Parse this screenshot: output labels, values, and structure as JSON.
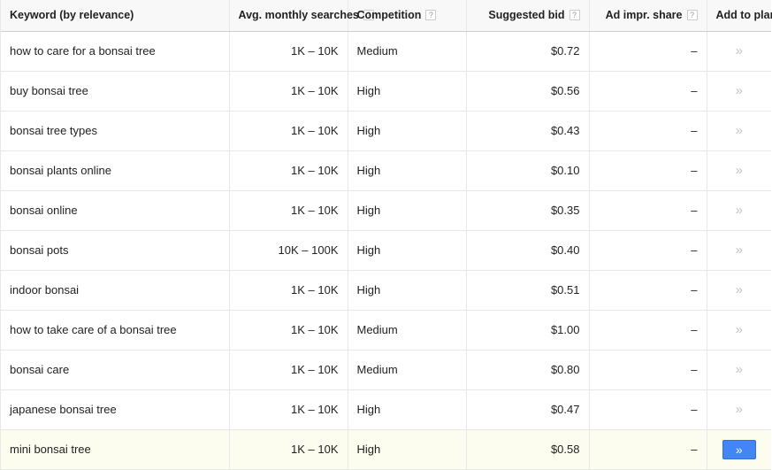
{
  "table": {
    "columns": [
      {
        "key": "keyword",
        "label": "Keyword (by relevance)",
        "help": false,
        "align": "left"
      },
      {
        "key": "searches",
        "label": "Avg. monthly searches",
        "help": true,
        "align": "right"
      },
      {
        "key": "competition",
        "label": "Competition",
        "help": true,
        "align": "left"
      },
      {
        "key": "bid",
        "label": "Suggested bid",
        "help": true,
        "align": "right"
      },
      {
        "key": "impr",
        "label": "Ad impr. share",
        "help": true,
        "align": "right"
      },
      {
        "key": "addplan",
        "label": "Add to plan",
        "help": false,
        "align": "left"
      }
    ],
    "help_glyph": "?",
    "chevron_glyph": "»",
    "accent_color": "#4285f4",
    "highlight_color": "#fcfcef",
    "rows": [
      {
        "keyword": "how to care for a bonsai tree",
        "searches": "1K – 10K",
        "competition": "Medium",
        "bid": "$0.72",
        "impr": "–",
        "highlighted": false
      },
      {
        "keyword": "buy bonsai tree",
        "searches": "1K – 10K",
        "competition": "High",
        "bid": "$0.56",
        "impr": "–",
        "highlighted": false
      },
      {
        "keyword": "bonsai tree types",
        "searches": "1K – 10K",
        "competition": "High",
        "bid": "$0.43",
        "impr": "–",
        "highlighted": false
      },
      {
        "keyword": "bonsai plants online",
        "searches": "1K – 10K",
        "competition": "High",
        "bid": "$0.10",
        "impr": "–",
        "highlighted": false
      },
      {
        "keyword": "bonsai online",
        "searches": "1K – 10K",
        "competition": "High",
        "bid": "$0.35",
        "impr": "–",
        "highlighted": false
      },
      {
        "keyword": "bonsai pots",
        "searches": "10K – 100K",
        "competition": "High",
        "bid": "$0.40",
        "impr": "–",
        "highlighted": false
      },
      {
        "keyword": "indoor bonsai",
        "searches": "1K – 10K",
        "competition": "High",
        "bid": "$0.51",
        "impr": "–",
        "highlighted": false
      },
      {
        "keyword": "how to take care of a bonsai tree",
        "searches": "1K – 10K",
        "competition": "Medium",
        "bid": "$1.00",
        "impr": "–",
        "highlighted": false
      },
      {
        "keyword": "bonsai care",
        "searches": "1K – 10K",
        "competition": "Medium",
        "bid": "$0.80",
        "impr": "–",
        "highlighted": false
      },
      {
        "keyword": "japanese bonsai tree",
        "searches": "1K – 10K",
        "competition": "High",
        "bid": "$0.47",
        "impr": "–",
        "highlighted": false
      },
      {
        "keyword": "mini bonsai tree",
        "searches": "1K – 10K",
        "competition": "High",
        "bid": "$0.58",
        "impr": "–",
        "highlighted": true
      }
    ]
  }
}
